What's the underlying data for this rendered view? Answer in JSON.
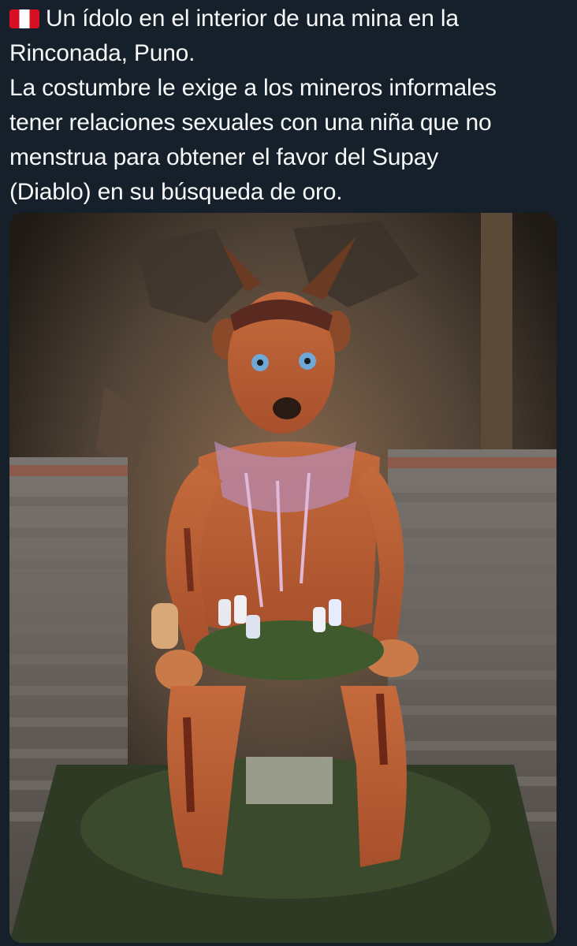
{
  "post": {
    "flag_icon": "peru-flag-icon",
    "text_lines": [
      "Un ídolo en el interior de una mina en la",
      "Rinconada, Puno.",
      "La costumbre le exige a los mineros informales",
      "tener relaciones sexuales con una niña que no",
      "menstrua para obtener el favor del Supay",
      "(Diablo) en su búsqueda de oro."
    ]
  },
  "media": {
    "image_subject": "el-tio-idol-photo"
  }
}
